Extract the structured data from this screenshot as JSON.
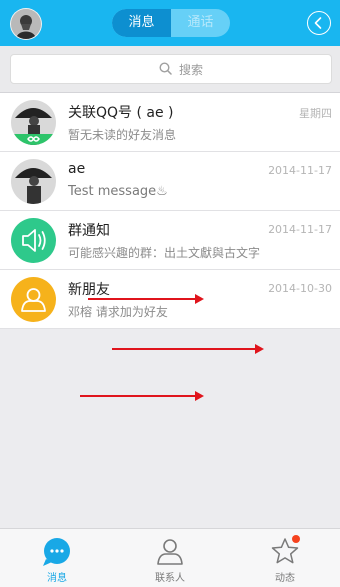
{
  "header": {
    "tabs": [
      {
        "label": "消息",
        "active": true
      },
      {
        "label": "通话",
        "active": false
      }
    ],
    "accent_color": "#19b6f0"
  },
  "search": {
    "placeholder": "搜索"
  },
  "conversations": [
    {
      "name": "关联QQ号 ( ae )",
      "message": "暂无未读的好友消息",
      "time": "星期四",
      "avatar": "user-photo-linked"
    },
    {
      "name": "ae",
      "message": "Test message♨",
      "time": "2014-11-17",
      "avatar": "user-photo"
    },
    {
      "name": "群通知",
      "message": "可能感兴趣的群：出土文獻與古文字",
      "time": "2014-11-17",
      "avatar": "speaker-icon"
    },
    {
      "name": "新朋友",
      "message": "邓榕 请求加为好友",
      "time": "2014-10-30",
      "avatar": "person-icon"
    }
  ],
  "tabbar": {
    "items": [
      {
        "label": "消息",
        "icon": "chat-bubble-icon",
        "active": true
      },
      {
        "label": "联系人",
        "icon": "contacts-icon",
        "active": false
      },
      {
        "label": "动态",
        "icon": "star-icon",
        "active": false,
        "badge": true
      }
    ]
  },
  "colors": {
    "header": "#19b6f0",
    "notice_green": "#2ec98b",
    "newfriend_orange": "#f6b21b",
    "badge_red": "#f5421e",
    "annotation_arrow": "#e0141c"
  }
}
